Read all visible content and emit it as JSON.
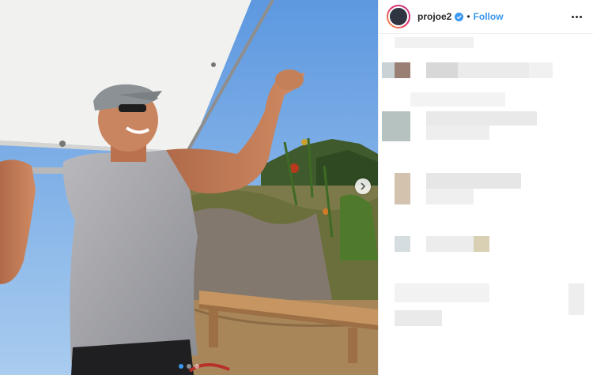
{
  "post": {
    "username": "projoe2",
    "separator": "•",
    "follow_label": "Follow",
    "carousel": {
      "total_slides": 3,
      "active_index": 0
    }
  },
  "colors": {
    "accent": "#3897f0",
    "text": "#262626",
    "border": "#efefef"
  },
  "icons": [
    "verified-badge-icon",
    "more-options-icon",
    "chevron-right-icon"
  ]
}
